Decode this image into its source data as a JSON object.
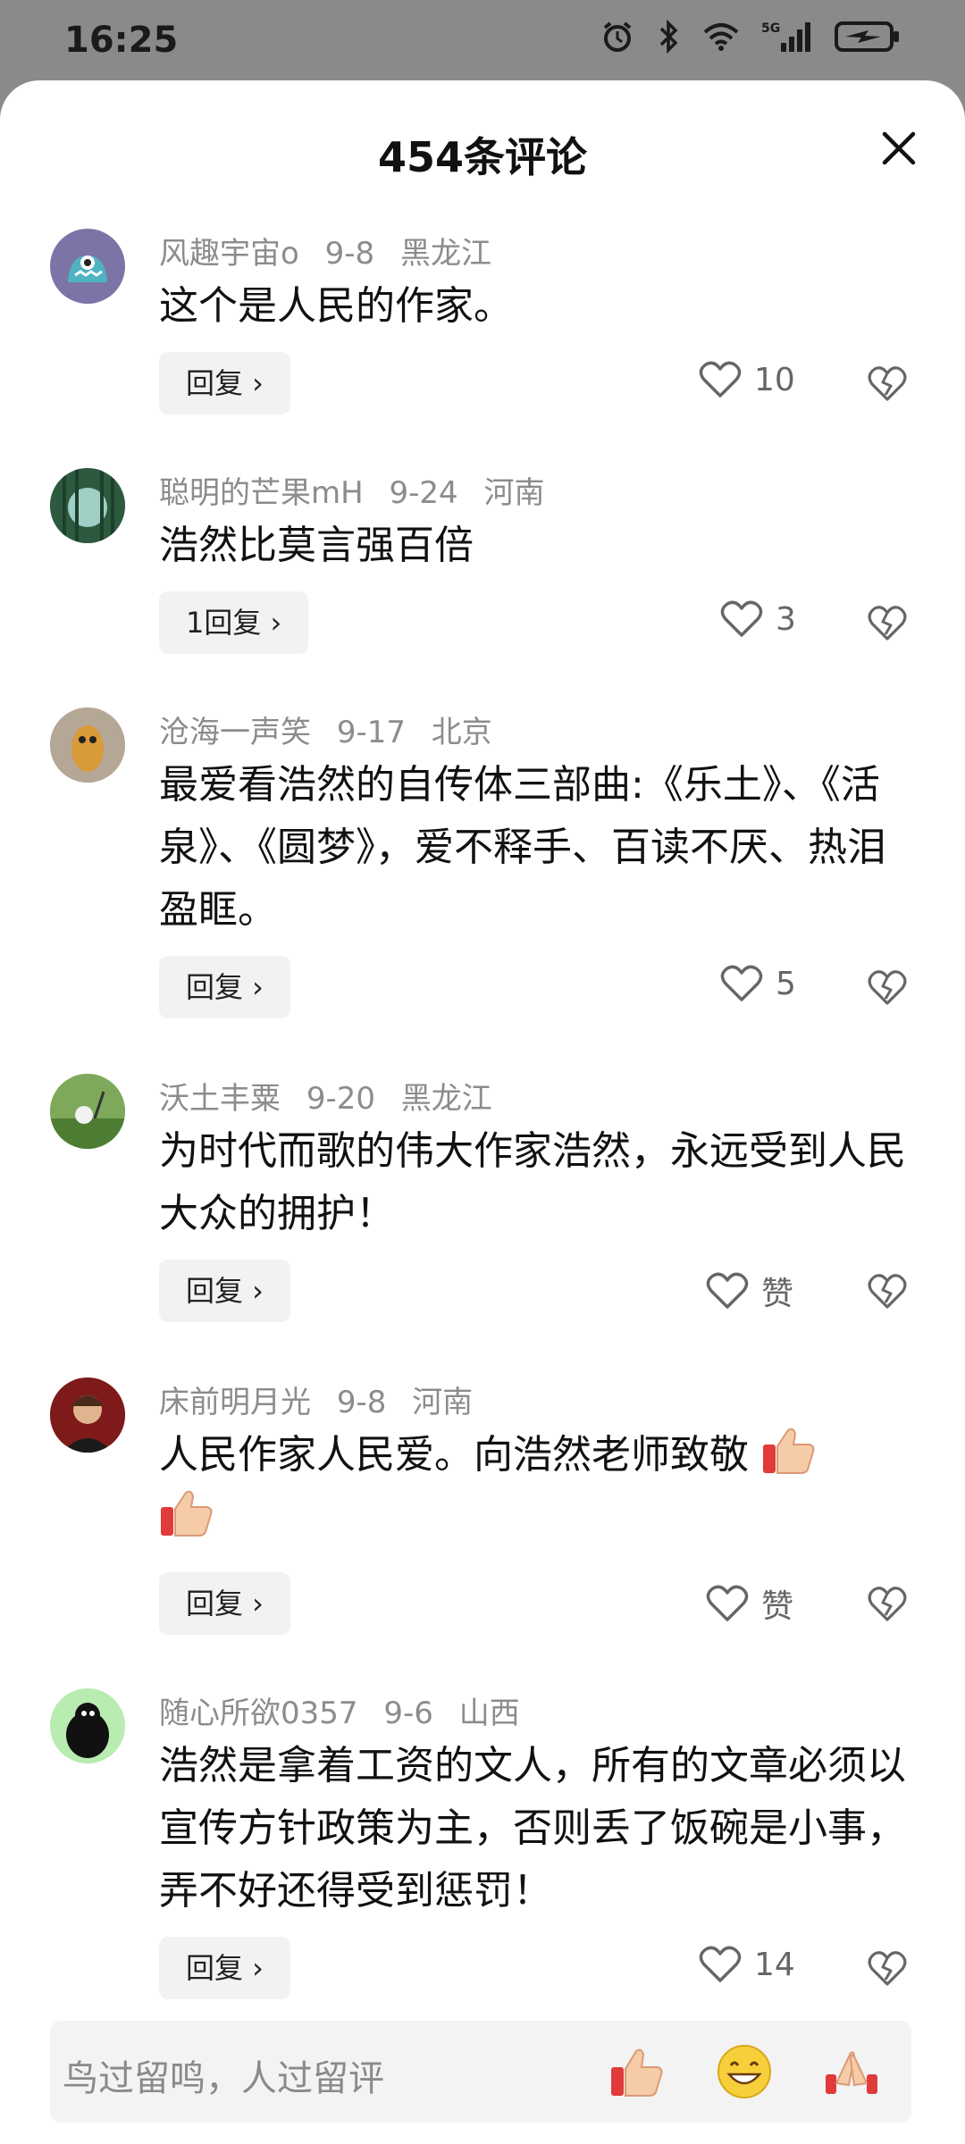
{
  "status": {
    "time": "16:25"
  },
  "header": {
    "title": "454条评论"
  },
  "comments": [
    {
      "user": "风趣宇宙o",
      "date": "9-8",
      "region": "黑龙江",
      "text": "这个是人民的作家。",
      "reply": "回复 ›",
      "likes": "10"
    },
    {
      "user": "聪明的芒果mH",
      "date": "9-24",
      "region": "河南",
      "text": "浩然比莫言强百倍",
      "reply": "1回复 ›",
      "likes": "3"
    },
    {
      "user": "沧海一声笑",
      "date": "9-17",
      "region": "北京",
      "text": "最爱看浩然的自传体三部曲:《乐土》、《活泉》、《圆梦》，爱不释手、百读不厌、热泪盈眶。",
      "reply": "回复 ›",
      "likes": "5"
    },
    {
      "user": "沃土丰粟",
      "date": "9-20",
      "region": "黑龙江",
      "text": "为时代而歌的伟大作家浩然，永远受到人民大众的拥护！",
      "reply": "回复 ›",
      "likes": "赞"
    },
    {
      "user": "床前明月光",
      "date": "9-8",
      "region": "河南",
      "text": "人民作家人民爱。向浩然老师致敬",
      "reply": "回复 ›",
      "likes": "赞"
    },
    {
      "user": "随心所欲0357",
      "date": "9-6",
      "region": "山西",
      "text": "浩然是拿着工资的文人，所有的文章必须以宣传方针政策为主，否则丢了饭碗是小事，弄不好还得受到惩罚！",
      "reply": "回复 ›",
      "likes": "14"
    }
  ],
  "input": {
    "placeholder": "鸟过留鸣，人过留评"
  },
  "icons": {
    "like": "heart-outline-icon",
    "dislike": "broken-heart-icon",
    "close": "close-icon",
    "emoji_thumb": "thumbs-up-emoji",
    "emoji_grin": "grinning-emoji",
    "emoji_clap": "clapping-hands-emoji"
  }
}
